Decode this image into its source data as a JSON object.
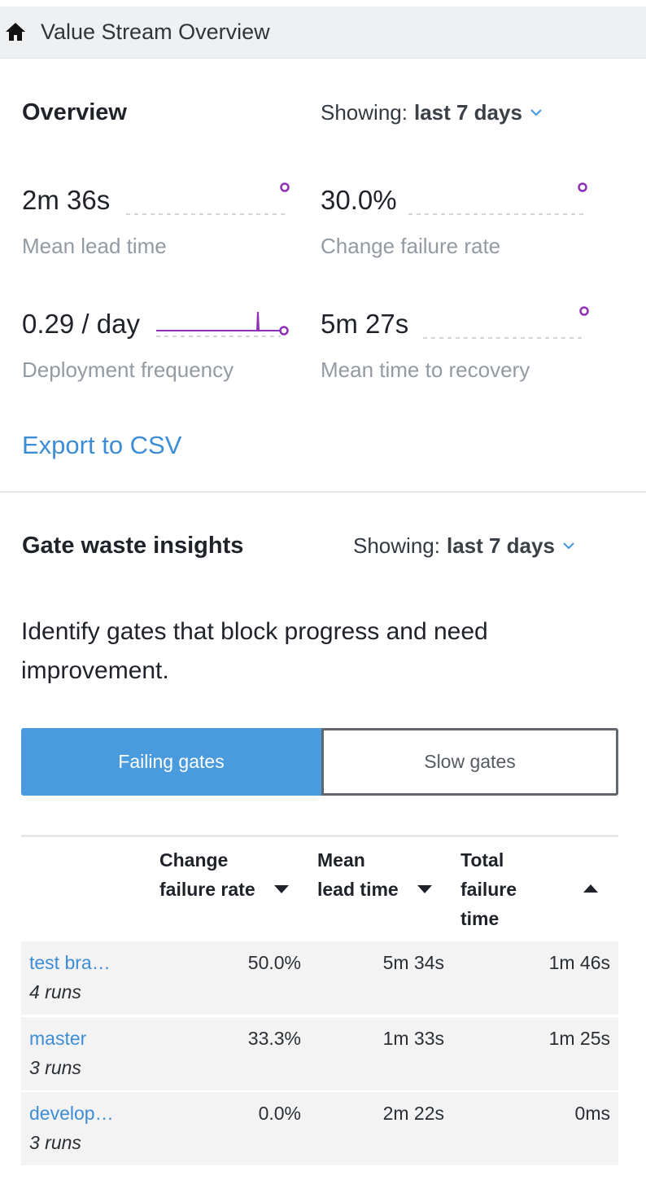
{
  "header": {
    "title": "Value Stream Overview",
    "icon": "home-icon"
  },
  "overview": {
    "title": "Overview",
    "showing_label": "Showing:",
    "range_value": "last 7 days",
    "metrics": [
      {
        "value": "2m 36s",
        "label": "Mean lead time"
      },
      {
        "value": "30.0%",
        "label": "Change failure rate"
      },
      {
        "value": "0.29 / day",
        "label": "Deployment frequency"
      },
      {
        "value": "5m 27s",
        "label": "Mean time to recovery"
      }
    ],
    "export_label": "Export to CSV"
  },
  "gates": {
    "title": "Gate waste insights",
    "showing_label": "Showing:",
    "range_value": "last 7 days",
    "description": "Identify gates that block progress and need improvement.",
    "tabs": [
      {
        "label": "Failing gates",
        "active": true
      },
      {
        "label": "Slow gates",
        "active": false
      }
    ],
    "columns": [
      {
        "label": "Change failure rate",
        "sort": "desc"
      },
      {
        "label": "Mean lead time",
        "sort": "desc"
      },
      {
        "label": "Total failure time",
        "sort": "asc"
      }
    ],
    "rows": [
      {
        "name": "test bra…",
        "runs": "4 runs",
        "change_failure_rate": "50.0%",
        "mean_lead_time": "5m 34s",
        "total_failure_time": "1m 46s"
      },
      {
        "name": "master",
        "runs": "3 runs",
        "change_failure_rate": "33.3%",
        "mean_lead_time": "1m 33s",
        "total_failure_time": "1m 25s"
      },
      {
        "name": "develop…",
        "runs": "3 runs",
        "change_failure_rate": "0.0%",
        "mean_lead_time": "2m 22s",
        "total_failure_time": "0ms"
      }
    ]
  },
  "colors": {
    "accent": "#4a9ade",
    "link": "#3d8dd6",
    "sparkline": "#8e2fb6",
    "muted_text": "#939aa2"
  }
}
